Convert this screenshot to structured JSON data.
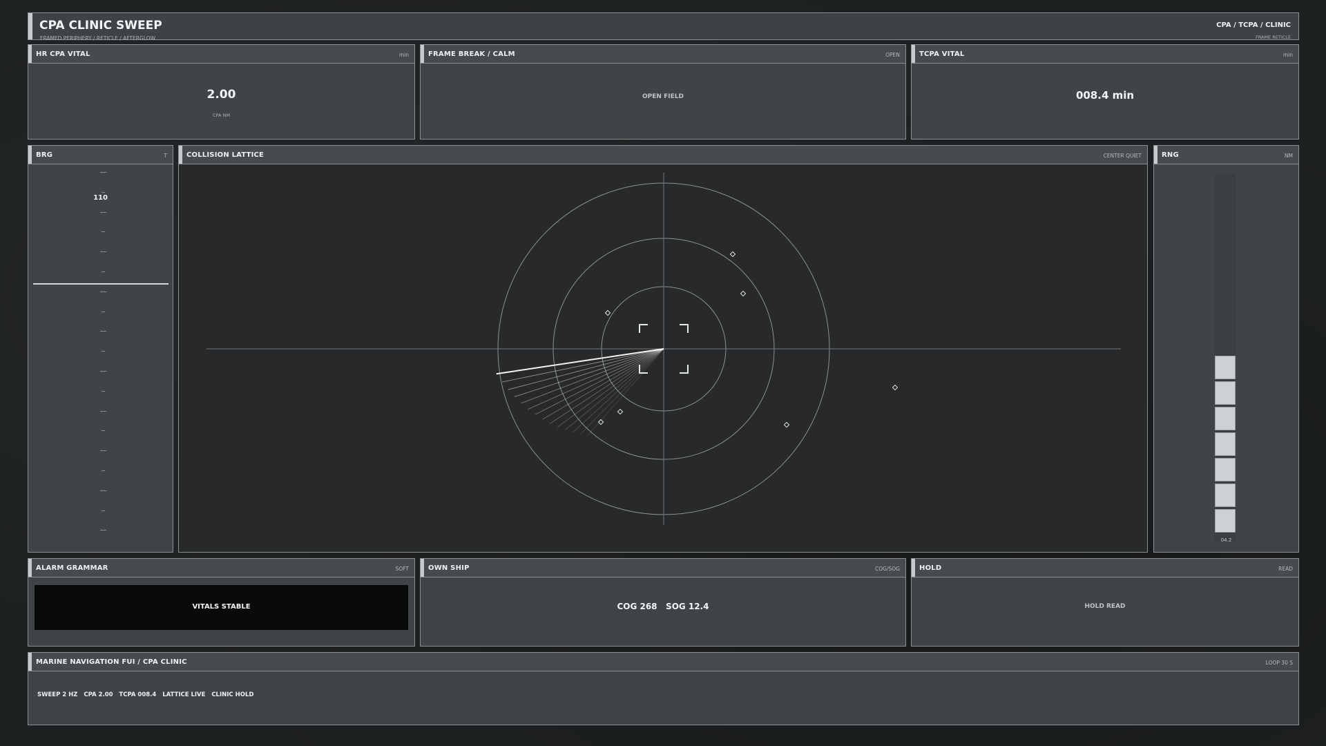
{
  "header": {
    "title": "CPA CLINIC SWEEP",
    "subtitle": "FRAMED PERIPHERY  /  RETICLE  /  AFTERGLOW",
    "right_title": "CPA / TCPA  /  CLINIC",
    "right_sub": "FRAME  RETICLE"
  },
  "hr_cpa": {
    "title": "HR  CPA VITAL",
    "unit": "min",
    "value": "2.00",
    "caption": "CPA NM"
  },
  "frame_break": {
    "title": "FRAME BREAK  /  CALM",
    "unit": "OPEN",
    "label": "OPEN FIELD"
  },
  "tcpa": {
    "title": "TCPA VITAL",
    "unit": "min",
    "value": "008.4 min"
  },
  "brg": {
    "title": "BRG",
    "unit": "T",
    "value": "110"
  },
  "lattice": {
    "title": "COLLISION LATTICE",
    "unit": "CENTER QUIET"
  },
  "rng": {
    "title": "RNG",
    "unit": "NM",
    "value": "04.2",
    "fill_fraction": 0.42
  },
  "alarm": {
    "title": "ALARM GRAMMAR",
    "unit": "SOFT",
    "status": "VITALS STABLE"
  },
  "own_ship": {
    "title": "OWN SHIP",
    "unit": "COG/SOG",
    "readout": "COG 268   SOG 12.4"
  },
  "hold": {
    "title": "HOLD",
    "unit": "READ",
    "label": "HOLD READ"
  },
  "footer": {
    "title": "MARINE NAVIGATION FUI  /  CPA CLINIC",
    "unit": "LOOP 30 S",
    "ticker": "SWEEP 2 HZ   CPA 2.00   TCPA 008.4   LATTICE LIVE   CLINIC HOLD"
  },
  "colors": {
    "panel": "#3f4546",
    "border": "#8a9193",
    "accent": "#c5cbcd",
    "lattice_bg": "#27292a"
  }
}
